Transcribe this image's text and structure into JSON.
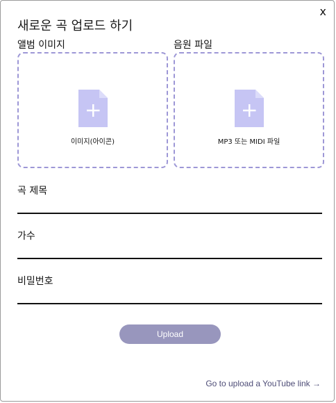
{
  "modal": {
    "title": "새로운 곡 업로드 하기",
    "close_label": "x"
  },
  "album_image": {
    "label": "앨범 이미지",
    "dropzone_text": "이미지(아이콘)",
    "icon": "file-add-icon"
  },
  "audio_file": {
    "label": "음원 파일",
    "dropzone_text": "MP3 또는 MIDI 파일",
    "icon": "file-add-icon"
  },
  "fields": {
    "song_title": {
      "label": "곡 제목",
      "value": ""
    },
    "artist": {
      "label": "가수",
      "value": ""
    },
    "password": {
      "label": "비밀번호",
      "value": ""
    }
  },
  "actions": {
    "upload_label": "Upload",
    "youtube_link_label": "Go to upload a YouTube link →"
  },
  "colors": {
    "dropzone_border": "#9d97d6",
    "file_icon": "#c6c5f4",
    "upload_button": "#9896bd",
    "link_text": "#4e4d77"
  }
}
